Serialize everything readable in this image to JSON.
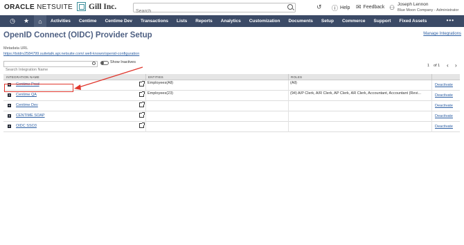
{
  "header": {
    "logo_bold": "ORACLE",
    "logo_light": " NETSUITE",
    "company_name": "Gill Inc.",
    "search_placeholder": "Search",
    "help_label": "Help",
    "feedback_label": "Feedback",
    "user_name": "Joseph Lennon",
    "user_role": "Blue Moon Company - Administrator"
  },
  "nav": {
    "items": [
      "Activities",
      "Centime",
      "Centime Dev",
      "Transactions",
      "Lists",
      "Reports",
      "Analytics",
      "Customization",
      "Documents",
      "Setup",
      "Commerce",
      "Support",
      "Fixed Assets"
    ],
    "more": "•••"
  },
  "page": {
    "title": "OpenID Connect (OIDC) Provider Setup",
    "manage_link": "Manage Integrations",
    "metadata_label": "Metadata URL",
    "metadata_url": "https://tstdrv2584799.suitetalk.api.netsuite.com/.well-known/openid-configuration",
    "filter_placeholder": "Search Integration Name",
    "show_inactives": "Show Inactives",
    "pager_current": "1",
    "pager_total": "of 1"
  },
  "table": {
    "headers": [
      "INTEGRATION NAME",
      "ENTITIES",
      "ROLES"
    ],
    "rows": [
      {
        "name": "Centime Prod",
        "entities": "Employees(All)",
        "roles": "(All)",
        "action": "Deactivate"
      },
      {
        "name": "Centime QA",
        "entities": "Employees(23)",
        "roles": "(94) A/P Clerk, A/R Clerk, AP Clerk, AR Clerk, Accountant, Accountant (Revi...",
        "action": "Deactivate"
      },
      {
        "name": "Centime Dev",
        "entities": "",
        "roles": "",
        "action": "Deactivate"
      },
      {
        "name": "CENTIME SOAP",
        "entities": "",
        "roles": "",
        "action": "Deactivate"
      },
      {
        "name": "OIDC SSO3",
        "entities": "",
        "roles": "",
        "action": "Deactivate"
      }
    ]
  },
  "colors": {
    "nav_bg": "#3b4a66",
    "title": "#4d5f82",
    "link": "#2d5fa3",
    "annotation": "#e0352b"
  },
  "icons": [
    "recent-icon",
    "star-icon",
    "home-icon",
    "history-icon",
    "help-icon",
    "feedback-icon",
    "user-icon",
    "search-icon",
    "expand-icon",
    "external-link-icon"
  ]
}
